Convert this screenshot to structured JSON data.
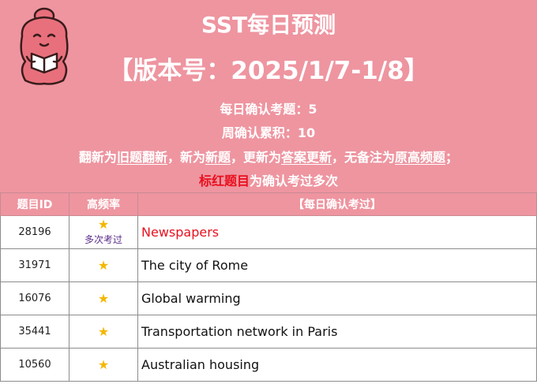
{
  "header": {
    "title": "SST每日预测",
    "version": "【版本号：2025/1/7-1/8】",
    "daily_count": "每日确认考题：5",
    "weekly_count": "周确认累积：10",
    "legend": {
      "p1": "翻新为",
      "old_renew": "旧题翻新",
      "p2": "，新为",
      "new_q": "新题",
      "p3": "，更新为",
      "ans_update": "答案更新",
      "p4": "，无备注为",
      "orig_freq": "原高频题",
      "p5": "；"
    },
    "red_note": {
      "red": "标红题目",
      "rest": "为确认考过多次"
    }
  },
  "table": {
    "headers": [
      "题目ID",
      "高频率",
      "【每日确认考过】"
    ],
    "rows": [
      {
        "id": "28196",
        "star": "★",
        "note": "多次考过",
        "topic": "Newspapers",
        "highlight": true
      },
      {
        "id": "31971",
        "star": "★",
        "note": "",
        "topic": "The city of Rome",
        "highlight": false
      },
      {
        "id": "16076",
        "star": "★",
        "note": "",
        "topic": "Global warming",
        "highlight": false
      },
      {
        "id": "35441",
        "star": "★",
        "note": "",
        "topic": "Transportation network in Paris",
        "highlight": false
      },
      {
        "id": "10560",
        "star": "★",
        "note": "",
        "topic": "Australian housing",
        "highlight": false
      }
    ]
  },
  "colors": {
    "header_bg": "#ee95a0",
    "highlight": "#e8101e",
    "star": "#f3b800",
    "mascot": "#e8707c"
  },
  "icons": {
    "mascot": "cartoon-reading-mascot-icon",
    "star": "star-icon"
  }
}
